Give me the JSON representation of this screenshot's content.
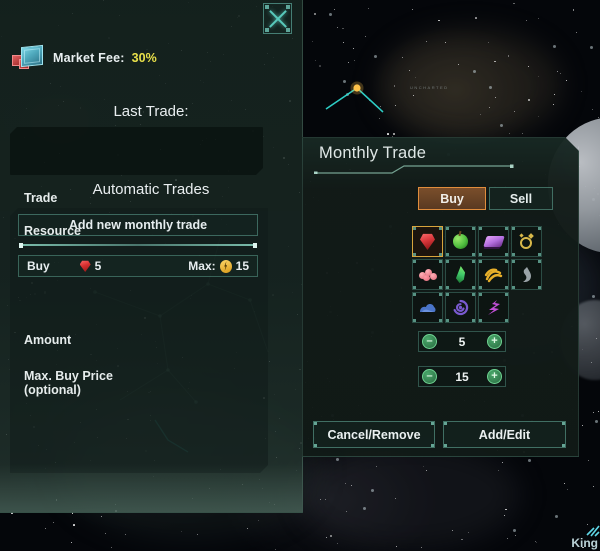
{
  "window": {
    "close_icon": "close-x-icon"
  },
  "left_panel": {
    "market_fee_label": "Market Fee:",
    "market_fee_value": "30%",
    "market_fee_icon": "crate-resources-icon",
    "last_trade_heading": "Last Trade:",
    "last_trade_content": "",
    "automatic_trades_heading": "Automatic Trades",
    "add_new_trade_label": "Add new monthly trade",
    "trades": [
      {
        "action": "Buy",
        "amount": "5",
        "amount_icon": "minerals-gem-icon",
        "max_label": "Max:",
        "max_value": "15",
        "max_icon": "energy-bolt-icon"
      }
    ]
  },
  "right_panel": {
    "title": "Monthly Trade",
    "trade_label": "Trade",
    "trade_options": [
      {
        "label": "Buy",
        "selected": true
      },
      {
        "label": "Sell",
        "selected": false
      }
    ],
    "resource_label": "Resource",
    "resources": [
      {
        "name": "minerals",
        "icon": "red-gem-icon",
        "color": "#d8363a",
        "selected": true
      },
      {
        "name": "food",
        "icon": "green-apple-icon",
        "color": "#4fbe3f",
        "selected": false
      },
      {
        "name": "consumer-goods",
        "icon": "purple-bar-icon",
        "color": "#b46fe0",
        "selected": false
      },
      {
        "name": "alloys",
        "icon": "gold-ring-icon",
        "color": "#d8b84a",
        "selected": false
      },
      {
        "name": "rare-crystals",
        "icon": "pink-crystal-cluster-icon",
        "color": "#e06a7a",
        "selected": false
      },
      {
        "name": "exotic-gases",
        "icon": "green-flame-icon",
        "color": "#3fc86a",
        "selected": false
      },
      {
        "name": "volatile-motes",
        "icon": "yellow-swirl-icon",
        "color": "#e8b02a",
        "selected": false
      },
      {
        "name": "living-metal",
        "icon": "grey-liquid-metal-icon",
        "color": "#9aa3a8",
        "selected": false
      },
      {
        "name": "zro",
        "icon": "blue-cloud-icon",
        "color": "#4a74c8",
        "selected": false
      },
      {
        "name": "dark-matter",
        "icon": "purple-spiral-icon",
        "color": "#7a5ad0",
        "selected": false
      },
      {
        "name": "nanites",
        "icon": "magenta-glyph-icon",
        "color": "#c24fd8",
        "selected": false
      }
    ],
    "amount_label": "Amount",
    "amount_value": "5",
    "max_price_label": "Max. Buy Price",
    "max_price_sublabel": "(optional)",
    "max_price_value": "15",
    "decrement_label": "–",
    "increment_label": "+",
    "cancel_label": "Cancel/Remove",
    "confirm_label": "Add/Edit"
  },
  "background": {
    "watermark": "King",
    "system_label": ""
  },
  "colors": {
    "accent_teal": "#58c9bb",
    "accent_orange": "#e08d3c",
    "fee_yellow": "#e8e04a",
    "panel_dark": "#131b18",
    "panel_green": "#1a2a26"
  }
}
